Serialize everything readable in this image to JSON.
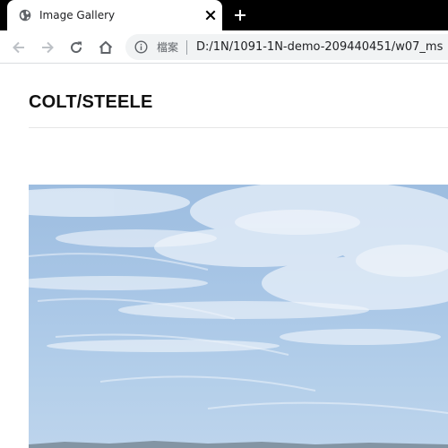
{
  "browser": {
    "tab": {
      "title": "Image Gallery",
      "favicon": "globe-icon",
      "close_icon": "close-icon"
    },
    "new_tab_icon": "plus-icon",
    "toolbar": {
      "back_icon": "arrow-left-icon",
      "forward_icon": "arrow-right-icon",
      "reload_icon": "reload-icon",
      "home_icon": "home-icon",
      "info_icon": "info-icon",
      "site_label": "檔案",
      "url": "D:/1N/1091-1N-demo-209440451/w07_ms"
    }
  },
  "page": {
    "brand": "COLT/STEELE",
    "photo_subject": "sky-with-clouds"
  },
  "colors": {
    "tabstrip_bg": "#000000",
    "omnibox_bg": "#f1f3f4",
    "sky": "#a8c6e6"
  }
}
